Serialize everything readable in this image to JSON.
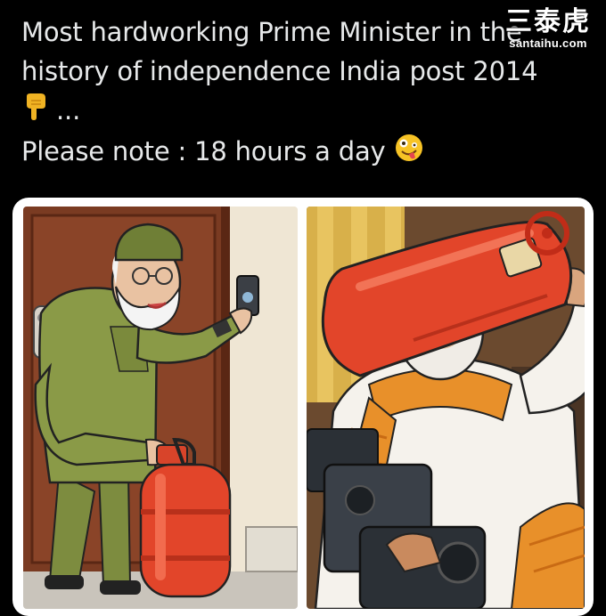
{
  "post": {
    "line1": "Most hardworking Prime Minister in the",
    "line2": "history of independence India post 2014",
    "line3_suffix": "...",
    "line4_text": "Please note : 18 hours a day",
    "emoji_pointing": "backhand-index-pointing-down",
    "emoji_face": "zany-face"
  },
  "watermark": {
    "logo": "三泰虎",
    "domain": "santaihu.com"
  },
  "media": {
    "panels": [
      "left-panel-doorbell",
      "right-panel-cylinder-camera"
    ]
  },
  "colors": {
    "background": "#000000",
    "text": "#e7e9ea",
    "cylinder_red": "#e2452a",
    "uniform_green": "#8a9a47",
    "card_border": "#ffffff"
  }
}
